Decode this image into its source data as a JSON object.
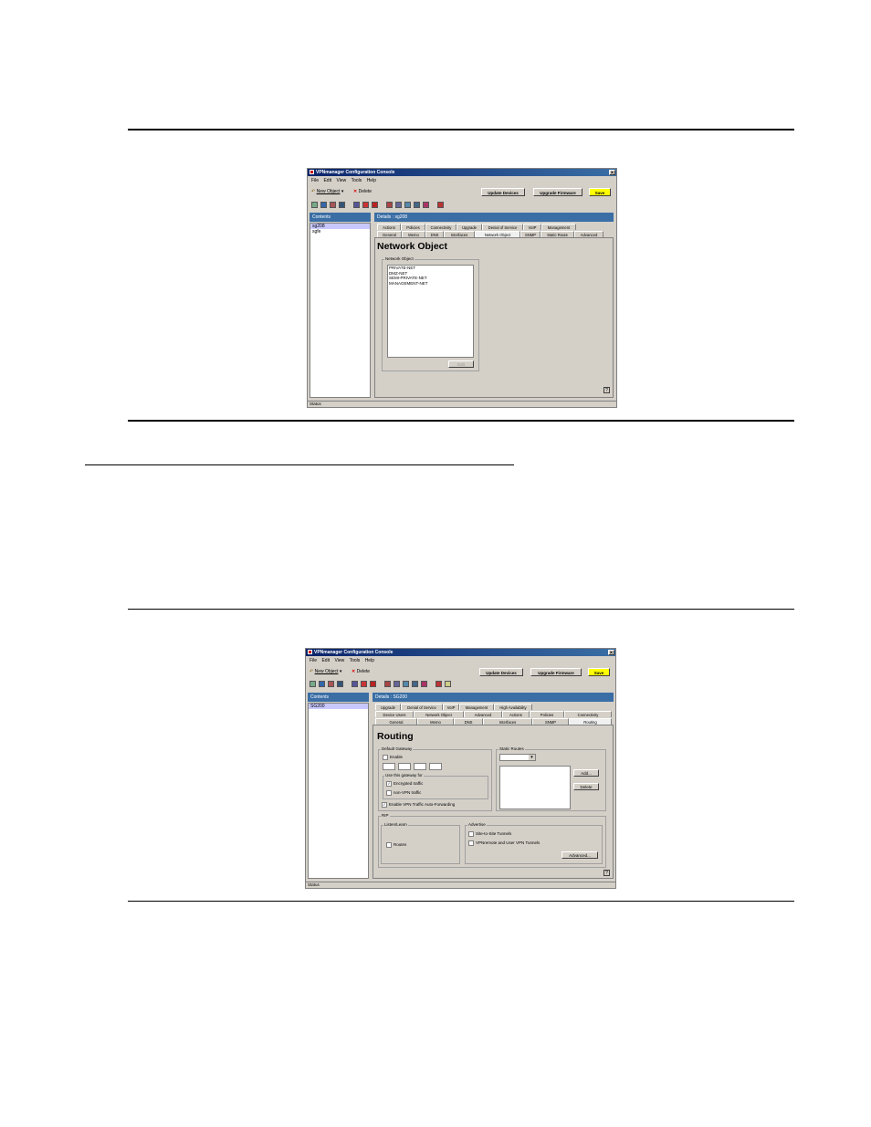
{
  "screen1": {
    "title": "VPNmanager Configuration Console",
    "menu": [
      "File",
      "Edit",
      "View",
      "Tools",
      "Help"
    ],
    "toolbar": {
      "new_object": "New Object",
      "delete": "Delete",
      "update_devices": "Update Devices",
      "upgrade_firmware": "Upgrade Firmware",
      "save": "Save"
    },
    "contents_label": "Contents",
    "tree_items": [
      "sg208",
      "sgfe"
    ],
    "details_label": "Details : sg208",
    "tabs_row1": [
      "Actions",
      "Policies",
      "Connectivity",
      "Upgrade",
      "Denial of Service",
      "VoIP",
      "Management"
    ],
    "tabs_row2": [
      "General",
      "Memo",
      "DNS",
      "Interfaces",
      "Network Object",
      "SNMP",
      "Static Route",
      "Advanced"
    ],
    "heading": "Network Object",
    "group_label": "Network Object",
    "list_items": [
      "PRIVATE-NET",
      "DMZ-NET",
      "SEMI-PRIVATE-NET",
      "MANAGEMENT-NET"
    ],
    "edit_button": "Edit",
    "help": "?",
    "status": "Status"
  },
  "screen2": {
    "title": "VPNmanager Configuration Console",
    "menu": [
      "File",
      "Edit",
      "View",
      "Tools",
      "Help"
    ],
    "toolbar": {
      "new_object": "New Object",
      "delete": "Delete",
      "update_devices": "Update Devices",
      "upgrade_firmware": "Upgrade Firmware",
      "save": "Save"
    },
    "contents_label": "Contents",
    "tree_items": [
      "SG200"
    ],
    "details_label": "Details : SG200",
    "tabs_row1": [
      "Upgrade",
      "Denial of Service",
      "VoIP",
      "Management",
      "High Availability"
    ],
    "tabs_row2": [
      "Device Users",
      "Network Object",
      "Advanced",
      "Actions",
      "Policies",
      "Connectivity"
    ],
    "tabs_row3": [
      "General",
      "Memo",
      "DNS",
      "Interfaces",
      "SNMP",
      "Routing"
    ],
    "heading": "Routing",
    "default_gateway": {
      "label": "Default Gateway",
      "enable": "Enable",
      "use_for": "Use this gateway for",
      "encrypted": "Encrypted traffic",
      "non_vpn": "non-VPN traffic",
      "auto_forward": "Enable VPN Traffic Auto-Forwarding"
    },
    "static_routes": {
      "label": "Static Routes",
      "add": "Add...",
      "delete": "Delete"
    },
    "rip": {
      "label": "RIP",
      "listen_label": "Listen/Learn",
      "routes": "Routes",
      "advertise_label": "Advertise",
      "site_to_site": "Site-to-Site Tunnels",
      "vpnremote": "VPNremote and User VPN Tunnels",
      "advanced": "Advanced..."
    },
    "help": "?",
    "status": "Status"
  }
}
